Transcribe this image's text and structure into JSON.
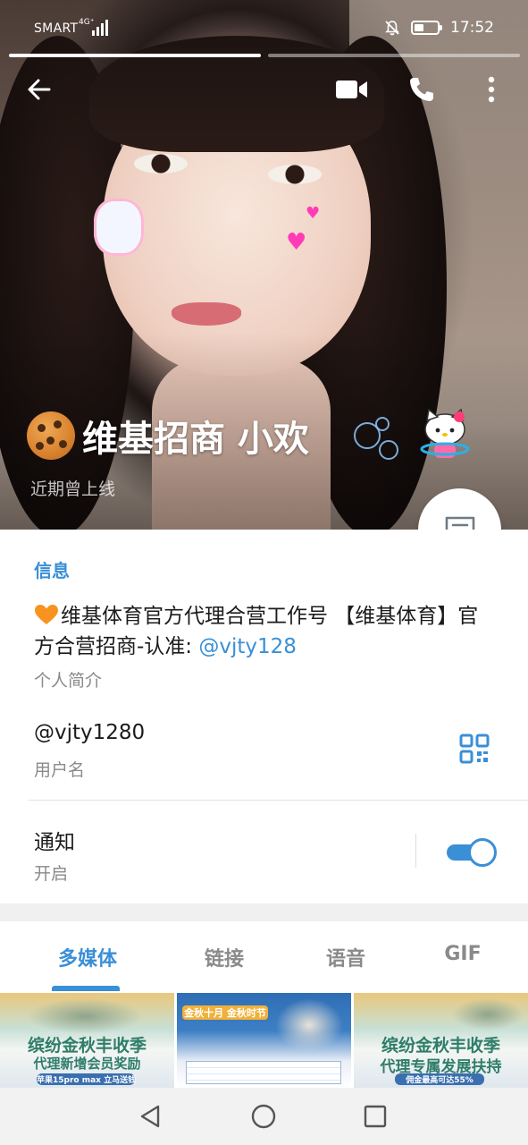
{
  "status_bar": {
    "carrier": "SMART",
    "network": "4G⁺",
    "time": "17:52"
  },
  "profile": {
    "name": "维基招商 小欢",
    "last_seen": "近期曾上线"
  },
  "info": {
    "section_title": "信息",
    "bio_text": "维基体育官方代理合营工作号 【维基体育】官方合营招商-认准: ",
    "bio_link": "@vjty128",
    "bio_label": "个人简介",
    "username": "@vjty1280",
    "username_label": "用户名",
    "notify_title": "通知",
    "notify_status": "开启",
    "notify_on": true
  },
  "tabs": [
    {
      "label": "多媒体",
      "active": true
    },
    {
      "label": "链接",
      "active": false
    },
    {
      "label": "语音",
      "active": false
    },
    {
      "label": "GIF",
      "active": false
    }
  ],
  "thumbnails": [
    {
      "caption_line1": "缤纷金秋丰收季",
      "caption_line2": "代理新增会员奖励",
      "caption_line3": "苹果15pro max 立马送钱"
    },
    {
      "caption_line1": "金秋十月 金秋时节",
      "caption_line2": "",
      "caption_line3": ""
    },
    {
      "caption_line1": "缤纷金秋丰收季",
      "caption_line2": "代理专属发展扶持",
      "caption_line3": "佣金最高可达55%"
    }
  ],
  "colors": {
    "accent": "#3a8fd6",
    "text_primary": "#1b1b1b",
    "text_secondary": "#8a8a8a"
  }
}
